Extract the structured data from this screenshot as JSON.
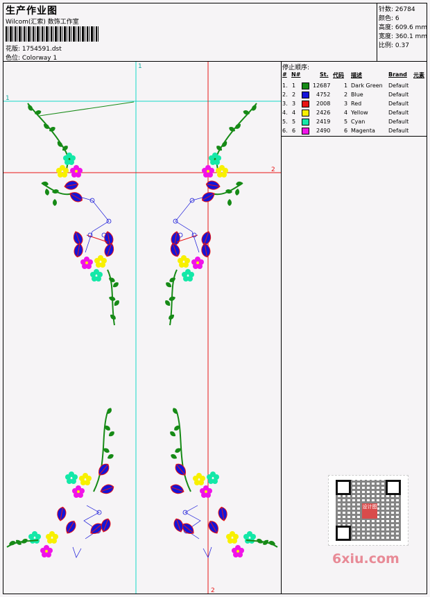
{
  "header": {
    "title": "生产作业图",
    "company": "Wilcom(汇索) 数饰工作室",
    "design_label": "花版: 1754591.dst",
    "colorway_label": "色位: Colorway 1"
  },
  "stats": [
    {
      "key": "针数",
      "value": "26784"
    },
    {
      "key": "颜色",
      "value": "6"
    },
    {
      "key": "高度",
      "value": "609.6 mm"
    },
    {
      "key": "宽度",
      "value": "360.1 mm"
    },
    {
      "key": "比例",
      "value": "0.37"
    }
  ],
  "guides": {
    "cyan_v_label": "1",
    "cyan_h_label": "1",
    "red_h_label": "2",
    "red_v_label": "2"
  },
  "stop_sequence": {
    "title": "停止顺序:",
    "headers": [
      "#",
      "N#",
      "St.",
      "代码",
      "描述",
      "Brand",
      "元素"
    ],
    "rows": [
      {
        "num": "1.",
        "n": "1",
        "color": "#168a16",
        "st": "12687",
        "code": "1",
        "desc": "Dark Green",
        "brand": "Default"
      },
      {
        "num": "2.",
        "n": "2",
        "color": "#1414d8",
        "st": "4752",
        "code": "2",
        "desc": "Blue",
        "brand": "Default"
      },
      {
        "num": "3.",
        "n": "3",
        "color": "#e81414",
        "st": "2008",
        "code": "3",
        "desc": "Red",
        "brand": "Default"
      },
      {
        "num": "4.",
        "n": "4",
        "color": "#f8f000",
        "st": "2426",
        "code": "4",
        "desc": "Yellow",
        "brand": "Default"
      },
      {
        "num": "5.",
        "n": "5",
        "color": "#14e8a8",
        "st": "2419",
        "code": "5",
        "desc": "Cyan",
        "brand": "Default"
      },
      {
        "num": "6.",
        "n": "6",
        "color": "#f014e8",
        "st": "2490",
        "code": "6",
        "desc": "Magenta",
        "brand": "Default"
      }
    ]
  },
  "watermark": "6xiu.com",
  "qr_logo_text": "设计图"
}
